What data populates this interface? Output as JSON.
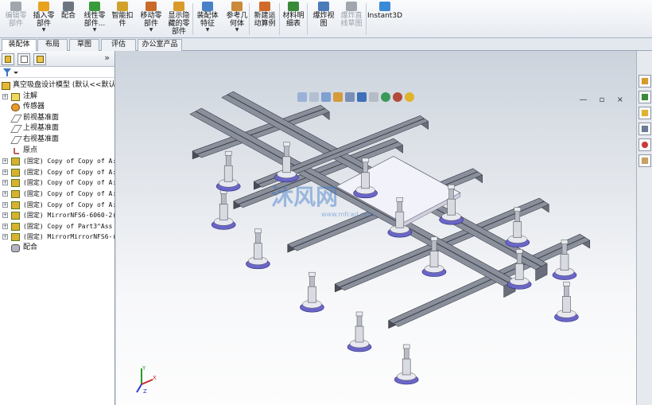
{
  "toolbar": {
    "buttons": [
      {
        "label": "编辑零\n部件",
        "icon": "edit-component-icon",
        "color": "#a0a6ae",
        "disabled": true
      },
      {
        "label": "插入零\n部件",
        "icon": "insert-component-icon",
        "color": "#e8a21c",
        "drop": "▼"
      },
      {
        "label": "配合",
        "icon": "mate-icon",
        "color": "#6c7580"
      },
      {
        "label": "线性零\n部件...",
        "icon": "linear-pattern-icon",
        "color": "#3a9b3a",
        "drop": "▼"
      },
      {
        "label": "智能扣\n件",
        "icon": "smart-fastener-icon",
        "color": "#d1a12b"
      },
      {
        "label": "移动零\n部件",
        "icon": "move-component-icon",
        "color": "#c96a2a",
        "drop": "▼"
      },
      {
        "label": "显示隐\n藏的零\n部件",
        "icon": "show-hidden-icon",
        "color": "#d99a2a"
      },
      {
        "label": "装配体\n特征",
        "icon": "assembly-features-icon",
        "color": "#4a80c8",
        "drop": "▼"
      },
      {
        "label": "参考几\n何体",
        "icon": "reference-geometry-icon",
        "color": "#c98a3a",
        "drop": "▼"
      },
      {
        "label": "新建运\n动算例",
        "icon": "motion-study-icon",
        "color": "#d06a2a"
      },
      {
        "label": "材料明\n细表",
        "icon": "bom-icon",
        "color": "#3a8a3a"
      },
      {
        "label": "爆炸视\n图",
        "icon": "exploded-view-icon",
        "color": "#4a7ab8"
      },
      {
        "label": "爆炸直\n线草图",
        "icon": "explode-line-sketch-icon",
        "color": "#a0a6ae",
        "disabled": true
      },
      {
        "label": "Instant3D",
        "icon": "instant3d-icon",
        "color": "#3a8ad8"
      }
    ]
  },
  "tabs": [
    {
      "label": "装配体",
      "active": true
    },
    {
      "label": "布局"
    },
    {
      "label": "草图"
    },
    {
      "label": "评估"
    },
    {
      "label": "办公室产品"
    }
  ],
  "left_panel": {
    "collapse_glyph": "»",
    "tree": [
      {
        "text": "真空吸盘设计模型  (默认<<默认",
        "icon": "assembly-icon",
        "root": true
      },
      {
        "text": "注解",
        "icon": "annotation-icon",
        "expand": "+"
      },
      {
        "text": "传感器",
        "icon": "sensor-icon"
      },
      {
        "text": "前视基准面",
        "icon": "plane-icon"
      },
      {
        "text": "上视基准面",
        "icon": "plane-icon"
      },
      {
        "text": "右视基准面",
        "icon": "plane-icon"
      },
      {
        "text": "原点",
        "icon": "origin-icon"
      },
      {
        "text": "(固定) Copy of Copy of A:",
        "icon": "subassembly-icon",
        "expand": "+",
        "mono": true
      },
      {
        "text": "(固定) Copy of Copy of A:",
        "icon": "subassembly-icon",
        "expand": "+",
        "mono": true
      },
      {
        "text": "(固定) Copy of Copy of A:",
        "icon": "subassembly-icon",
        "expand": "+",
        "mono": true
      },
      {
        "text": "(固定) Copy of Copy of A:",
        "icon": "subassembly-icon",
        "expand": "+",
        "mono": true
      },
      {
        "text": "(固定) Copy of Copy of A:",
        "icon": "subassembly-icon",
        "expand": "+",
        "mono": true
      },
      {
        "text": "(固定) MirrorNFS6-6060-2(",
        "icon": "subassembly-icon",
        "expand": "+",
        "mono": true
      },
      {
        "text": "(固定) Copy of Part3^Ass",
        "icon": "subassembly-icon",
        "expand": "+",
        "mono": true
      },
      {
        "text": "(固定) MirrorMirrorNFS6-(",
        "icon": "subassembly-icon",
        "expand": "+",
        "mono": true
      },
      {
        "text": "配合",
        "icon": "mates-folder-icon"
      }
    ]
  },
  "viewport": {
    "window_controls": "— ▫ ×",
    "watermark": "沐风网",
    "watermark_url": "www.mfcad.com",
    "triad": {
      "x": "X",
      "y": "Y",
      "z": "Z"
    }
  },
  "colors": {
    "beam": "#4a4d58",
    "beam_light": "#8a8f9c",
    "cup": "#6a66c8",
    "cup_top": "#e8e8f0",
    "plate": "#f2f2fa",
    "accent_blue": "#3a6fc0"
  }
}
